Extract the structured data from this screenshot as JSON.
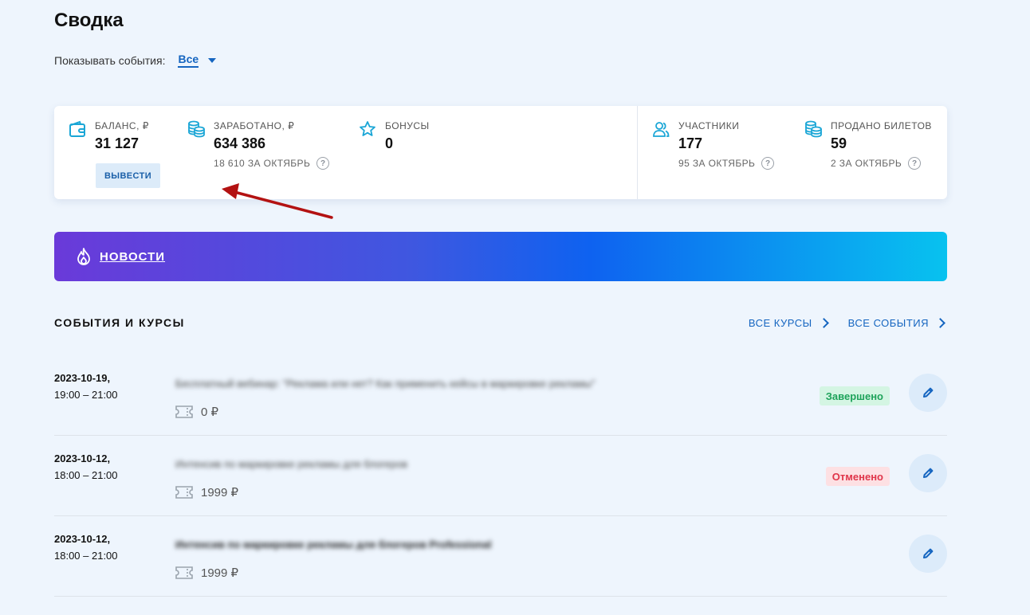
{
  "page": {
    "title": "Сводка"
  },
  "filter": {
    "label": "Показывать события:",
    "value": "Все"
  },
  "stats": {
    "balance": {
      "label": "БАЛАНС, ₽",
      "value": "31 127",
      "button": "ВЫВЕСТИ"
    },
    "earned": {
      "label": "ЗАРАБОТАНО, ₽",
      "value": "634 386",
      "sub": "18 610 ЗА ОКТЯБРЬ"
    },
    "bonuses": {
      "label": "БОНУСЫ",
      "value": "0"
    },
    "participants": {
      "label": "УЧАСТНИКИ",
      "value": "177",
      "sub": "95 ЗА ОКТЯБРЬ"
    },
    "tickets": {
      "label": "ПРОДАНО БИЛЕТОВ",
      "value": "59",
      "sub": "2 ЗА ОКТЯБРЬ"
    },
    "help_glyph": "?"
  },
  "news": {
    "label": "НОВОСТИ"
  },
  "section": {
    "title": "СОБЫТИЯ И КУРСЫ",
    "all_courses": "ВСЕ КУРСЫ",
    "all_events": "ВСЕ СОБЫТИЯ"
  },
  "events": [
    {
      "date": "2023-10-19,",
      "time": "19:00 – 21:00",
      "title": "Бесплатный вебинар: \"Реклама или нет? Как применить кейсы в маркировке рекламы\"",
      "price": "0 ₽",
      "status": "Завершено"
    },
    {
      "date": "2023-10-12,",
      "time": "18:00 – 21:00",
      "title": "Интенсив по маркировке рекламы для блогеров",
      "price": "1999 ₽",
      "status": "Отменено"
    },
    {
      "date": "2023-10-12,",
      "time": "18:00 – 21:00",
      "title": "Интенсив по маркировке рекламы для блогеров Professional",
      "price": "1999 ₽",
      "status": ""
    }
  ],
  "colors": {
    "accent": "#1565c0",
    "background": "#eef5fd",
    "done": "#1ea35a",
    "cancel": "#e0354a",
    "arrow": "#b31212"
  }
}
